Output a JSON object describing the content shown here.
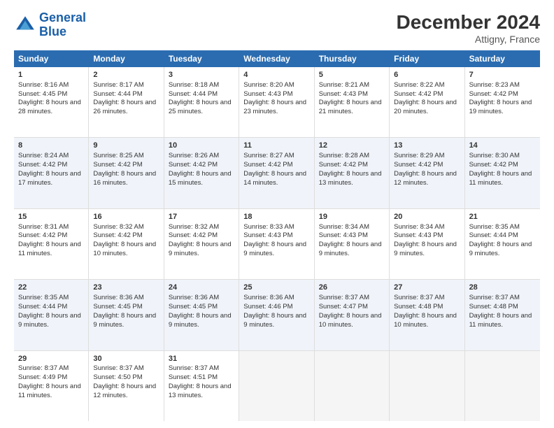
{
  "logo": {
    "line1": "General",
    "line2": "Blue"
  },
  "title": "December 2024",
  "subtitle": "Attigny, France",
  "days": [
    "Sunday",
    "Monday",
    "Tuesday",
    "Wednesday",
    "Thursday",
    "Friday",
    "Saturday"
  ],
  "weeks": [
    [
      {
        "day": "1",
        "sunrise": "8:16 AM",
        "sunset": "4:45 PM",
        "daylight": "8 hours and 28 minutes."
      },
      {
        "day": "2",
        "sunrise": "8:17 AM",
        "sunset": "4:44 PM",
        "daylight": "8 hours and 26 minutes."
      },
      {
        "day": "3",
        "sunrise": "8:18 AM",
        "sunset": "4:44 PM",
        "daylight": "8 hours and 25 minutes."
      },
      {
        "day": "4",
        "sunrise": "8:20 AM",
        "sunset": "4:43 PM",
        "daylight": "8 hours and 23 minutes."
      },
      {
        "day": "5",
        "sunrise": "8:21 AM",
        "sunset": "4:43 PM",
        "daylight": "8 hours and 21 minutes."
      },
      {
        "day": "6",
        "sunrise": "8:22 AM",
        "sunset": "4:42 PM",
        "daylight": "8 hours and 20 minutes."
      },
      {
        "day": "7",
        "sunrise": "8:23 AM",
        "sunset": "4:42 PM",
        "daylight": "8 hours and 19 minutes."
      }
    ],
    [
      {
        "day": "8",
        "sunrise": "8:24 AM",
        "sunset": "4:42 PM",
        "daylight": "8 hours and 17 minutes."
      },
      {
        "day": "9",
        "sunrise": "8:25 AM",
        "sunset": "4:42 PM",
        "daylight": "8 hours and 16 minutes."
      },
      {
        "day": "10",
        "sunrise": "8:26 AM",
        "sunset": "4:42 PM",
        "daylight": "8 hours and 15 minutes."
      },
      {
        "day": "11",
        "sunrise": "8:27 AM",
        "sunset": "4:42 PM",
        "daylight": "8 hours and 14 minutes."
      },
      {
        "day": "12",
        "sunrise": "8:28 AM",
        "sunset": "4:42 PM",
        "daylight": "8 hours and 13 minutes."
      },
      {
        "day": "13",
        "sunrise": "8:29 AM",
        "sunset": "4:42 PM",
        "daylight": "8 hours and 12 minutes."
      },
      {
        "day": "14",
        "sunrise": "8:30 AM",
        "sunset": "4:42 PM",
        "daylight": "8 hours and 11 minutes."
      }
    ],
    [
      {
        "day": "15",
        "sunrise": "8:31 AM",
        "sunset": "4:42 PM",
        "daylight": "8 hours and 11 minutes."
      },
      {
        "day": "16",
        "sunrise": "8:32 AM",
        "sunset": "4:42 PM",
        "daylight": "8 hours and 10 minutes."
      },
      {
        "day": "17",
        "sunrise": "8:32 AM",
        "sunset": "4:42 PM",
        "daylight": "8 hours and 9 minutes."
      },
      {
        "day": "18",
        "sunrise": "8:33 AM",
        "sunset": "4:43 PM",
        "daylight": "8 hours and 9 minutes."
      },
      {
        "day": "19",
        "sunrise": "8:34 AM",
        "sunset": "4:43 PM",
        "daylight": "8 hours and 9 minutes."
      },
      {
        "day": "20",
        "sunrise": "8:34 AM",
        "sunset": "4:43 PM",
        "daylight": "8 hours and 9 minutes."
      },
      {
        "day": "21",
        "sunrise": "8:35 AM",
        "sunset": "4:44 PM",
        "daylight": "8 hours and 9 minutes."
      }
    ],
    [
      {
        "day": "22",
        "sunrise": "8:35 AM",
        "sunset": "4:44 PM",
        "daylight": "8 hours and 9 minutes."
      },
      {
        "day": "23",
        "sunrise": "8:36 AM",
        "sunset": "4:45 PM",
        "daylight": "8 hours and 9 minutes."
      },
      {
        "day": "24",
        "sunrise": "8:36 AM",
        "sunset": "4:45 PM",
        "daylight": "8 hours and 9 minutes."
      },
      {
        "day": "25",
        "sunrise": "8:36 AM",
        "sunset": "4:46 PM",
        "daylight": "8 hours and 9 minutes."
      },
      {
        "day": "26",
        "sunrise": "8:37 AM",
        "sunset": "4:47 PM",
        "daylight": "8 hours and 10 minutes."
      },
      {
        "day": "27",
        "sunrise": "8:37 AM",
        "sunset": "4:48 PM",
        "daylight": "8 hours and 10 minutes."
      },
      {
        "day": "28",
        "sunrise": "8:37 AM",
        "sunset": "4:48 PM",
        "daylight": "8 hours and 11 minutes."
      }
    ],
    [
      {
        "day": "29",
        "sunrise": "8:37 AM",
        "sunset": "4:49 PM",
        "daylight": "8 hours and 11 minutes."
      },
      {
        "day": "30",
        "sunrise": "8:37 AM",
        "sunset": "4:50 PM",
        "daylight": "8 hours and 12 minutes."
      },
      {
        "day": "31",
        "sunrise": "8:37 AM",
        "sunset": "4:51 PM",
        "daylight": "8 hours and 13 minutes."
      },
      null,
      null,
      null,
      null
    ]
  ],
  "labels": {
    "sunrise": "Sunrise:",
    "sunset": "Sunset:",
    "daylight": "Daylight:"
  }
}
